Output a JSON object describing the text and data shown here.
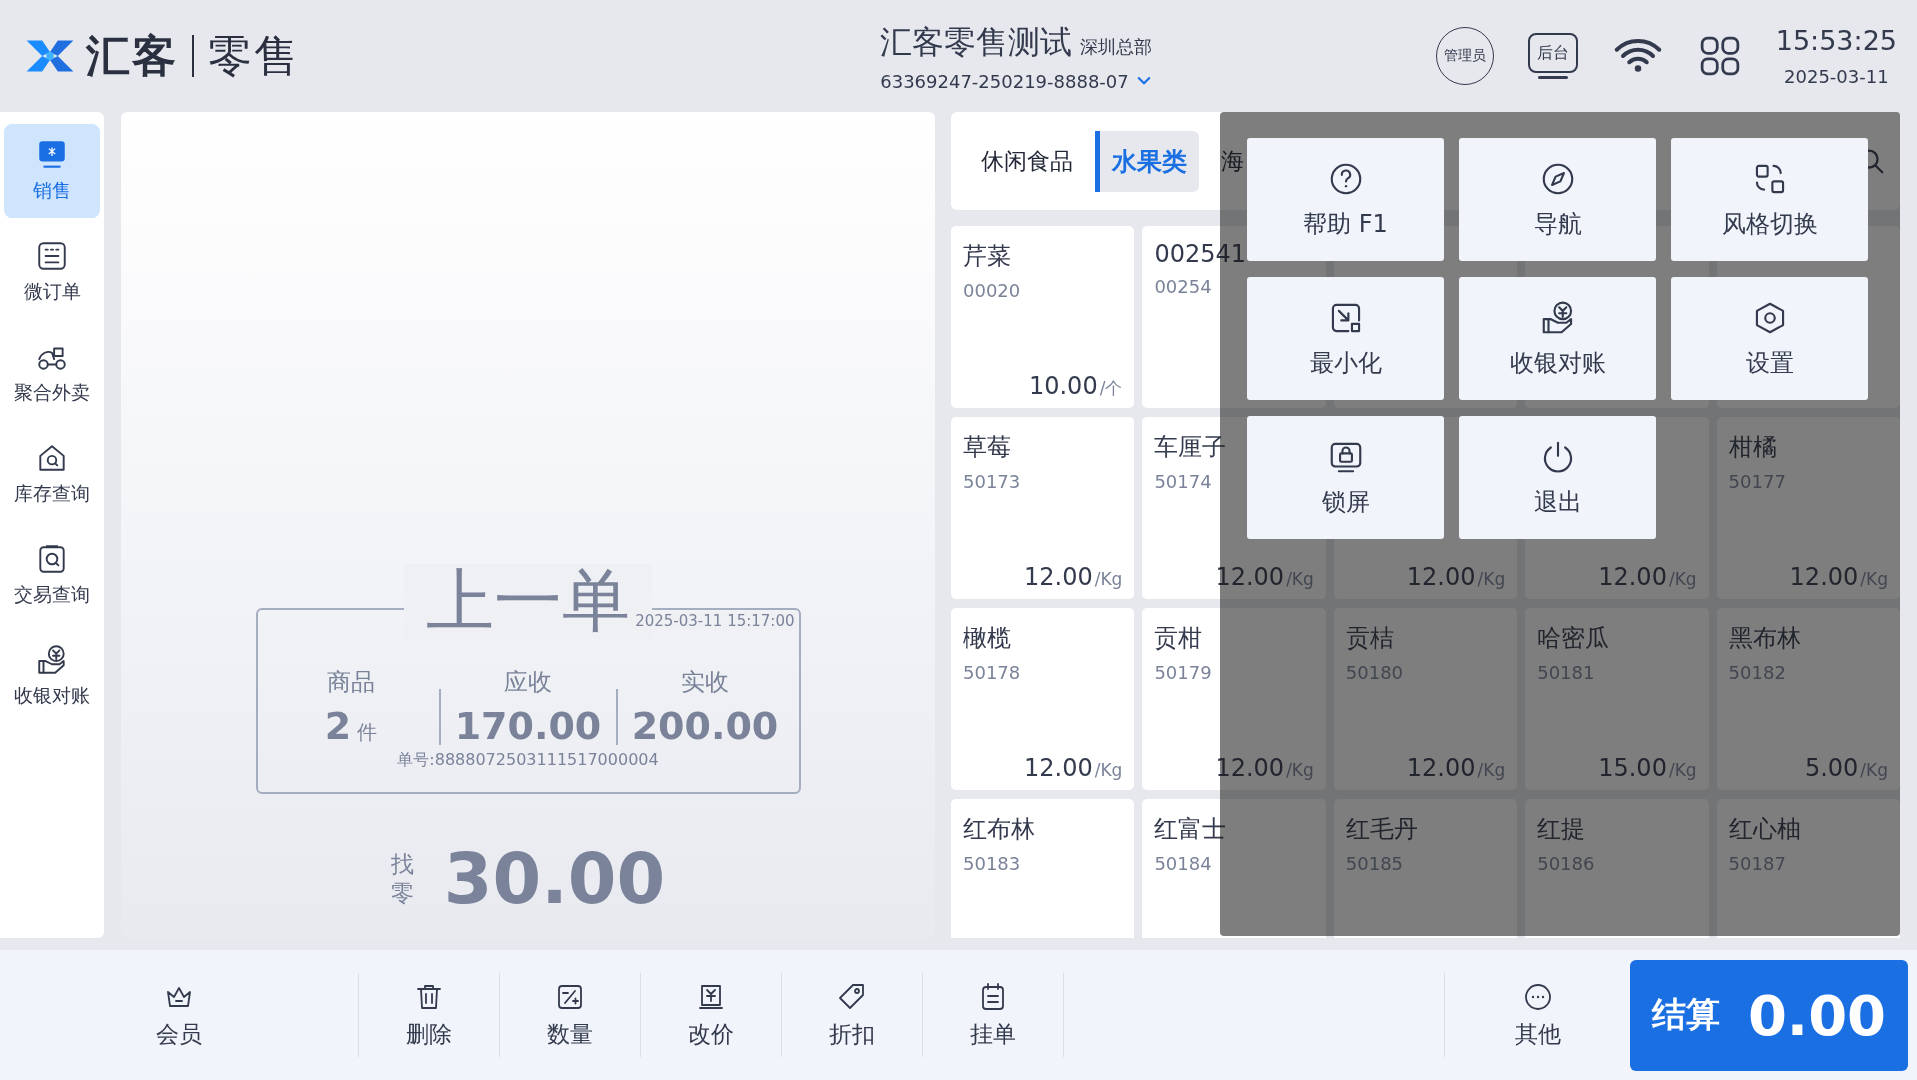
{
  "header": {
    "brand": "汇客",
    "product": "零售",
    "store_name": "汇客零售测试",
    "branch": "深圳总部",
    "terminal_id": "63369247-250219-8888-07",
    "role_badge": "管理员",
    "backoffice": "后台",
    "time": "15:53:25",
    "date": "2025-03-11"
  },
  "sidebar": {
    "items": [
      {
        "label": "销售",
        "selected": true
      },
      {
        "label": "微订单",
        "selected": false
      },
      {
        "label": "聚合外卖",
        "selected": false
      },
      {
        "label": "库存查询",
        "selected": false
      },
      {
        "label": "交易查询",
        "selected": false
      },
      {
        "label": "收银对账",
        "selected": false
      }
    ]
  },
  "last_order": {
    "title": "上一单",
    "time": "2025-03-11 15:17:00",
    "stats": [
      {
        "label": "商品",
        "value": "2",
        "unit": "件"
      },
      {
        "label": "应收",
        "value": "170.00"
      },
      {
        "label": "实收",
        "value": "200.00"
      }
    ],
    "order_no": "单号:8888072503111517000004",
    "change_label": "找零",
    "change": "30.00"
  },
  "categories": [
    {
      "label": "休闲食品",
      "selected": false
    },
    {
      "label": "水果类",
      "selected": true
    },
    {
      "label": "海",
      "selected": false
    }
  ],
  "products": [
    {
      "kind": "product",
      "name": "芹菜",
      "code": "00020",
      "price": "10.00",
      "unit": "/个"
    },
    {
      "kind": "product",
      "name": "002541",
      "code": "00254"
    },
    {
      "kind": "blank"
    },
    {
      "kind": "blank"
    },
    {
      "kind": "blank"
    },
    {
      "kind": "product",
      "name": "草莓",
      "code": "50173",
      "price": "12.00",
      "unit": "/Kg"
    },
    {
      "kind": "product",
      "name": "车厘子",
      "code": "50174",
      "price": "12.00",
      "unit": "/Kg"
    },
    {
      "kind": "product",
      "price": "12.00",
      "unit": "/Kg"
    },
    {
      "kind": "product",
      "price": "12.00",
      "unit": "/Kg"
    },
    {
      "kind": "product",
      "name": "柑橘",
      "code": "50177",
      "price": "12.00",
      "unit": "/Kg"
    },
    {
      "kind": "product",
      "name": "橄榄",
      "code": "50178",
      "price": "12.00",
      "unit": "/Kg"
    },
    {
      "kind": "product",
      "name": "贡柑",
      "code": "50179",
      "price": "12.00",
      "unit": "/Kg"
    },
    {
      "kind": "product",
      "name": "贡桔",
      "code": "50180",
      "price": "12.00",
      "unit": "/Kg"
    },
    {
      "kind": "product",
      "name": "哈密瓜",
      "code": "50181",
      "price": "15.00",
      "unit": "/Kg"
    },
    {
      "kind": "product",
      "name": "黑布林",
      "code": "50182",
      "price": "5.00",
      "unit": "/Kg"
    },
    {
      "kind": "product",
      "name": "红布林",
      "code": "50183"
    },
    {
      "kind": "product",
      "name": "红富士",
      "code": "50184"
    },
    {
      "kind": "product",
      "name": "红毛丹",
      "code": "50185"
    },
    {
      "kind": "product",
      "name": "红提",
      "code": "50186"
    },
    {
      "kind": "product",
      "name": "红心柚",
      "code": "50187"
    }
  ],
  "menu": {
    "items": [
      {
        "label": "帮助 F1"
      },
      {
        "label": "导航"
      },
      {
        "label": "风格切换"
      },
      {
        "label": "最小化"
      },
      {
        "label": "收银对账"
      },
      {
        "label": "设置"
      },
      {
        "label": "锁屏"
      },
      {
        "label": "退出"
      }
    ]
  },
  "toolbar": {
    "items": [
      {
        "label": "会员"
      },
      {
        "label": "删除"
      },
      {
        "label": "数量"
      },
      {
        "label": "改价"
      },
      {
        "label": "折扣"
      },
      {
        "label": "挂单"
      }
    ],
    "more": {
      "label": "其他"
    },
    "checkout": {
      "label": "结算",
      "amount": "0.00"
    }
  }
}
